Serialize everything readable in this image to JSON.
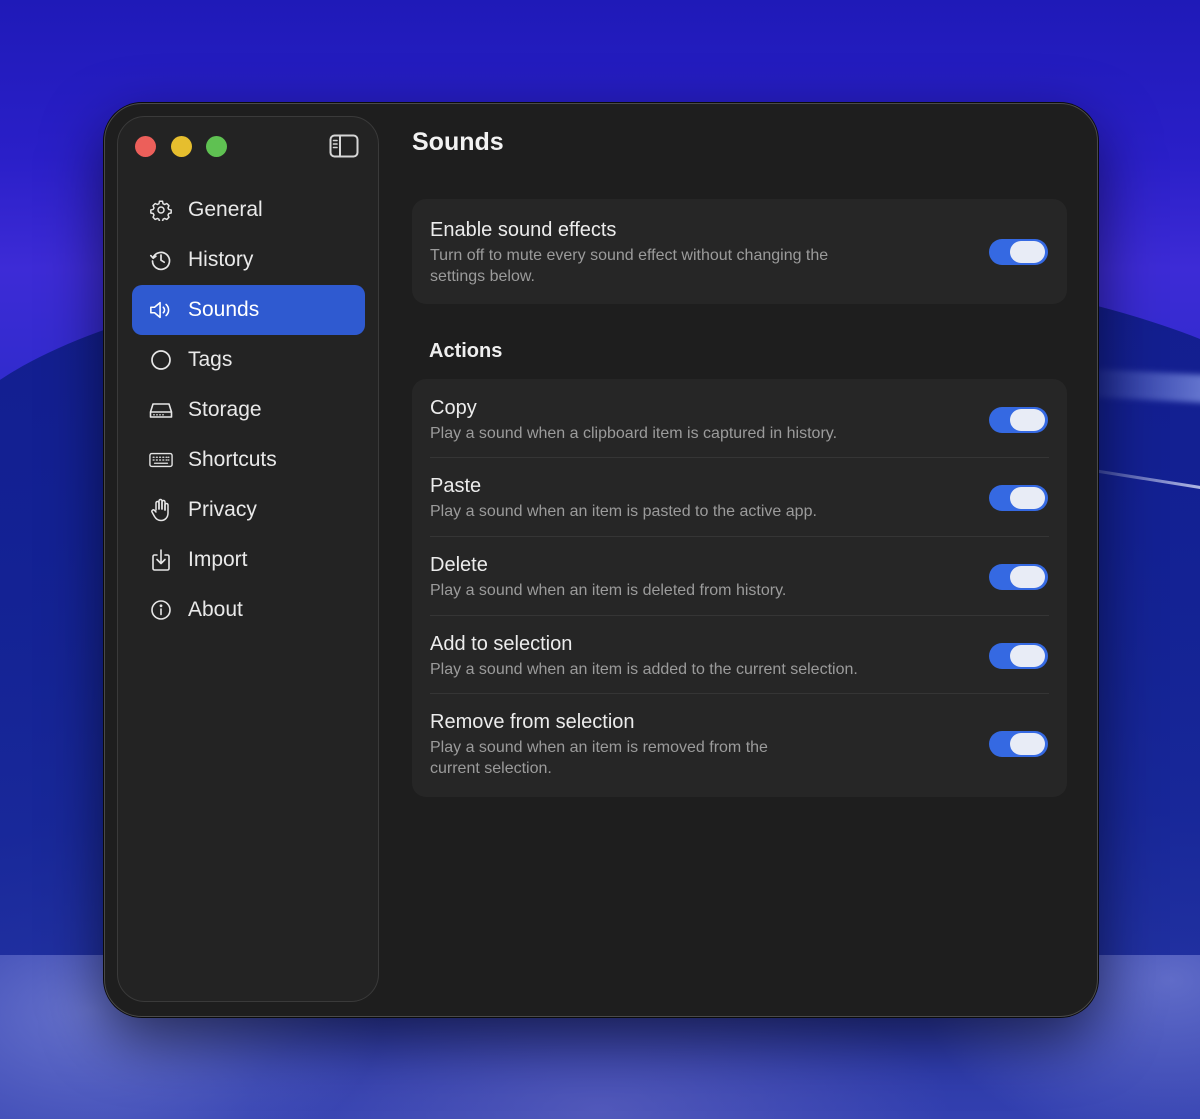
{
  "window": {
    "traffic_lights": [
      "close",
      "minimize",
      "zoom"
    ],
    "sidebar_toggle_icon": "sidebar-left-icon"
  },
  "sidebar": {
    "items": [
      {
        "label": "General",
        "icon": "gear-icon",
        "active": false
      },
      {
        "label": "History",
        "icon": "clock-history-icon",
        "active": false
      },
      {
        "label": "Sounds",
        "icon": "speaker-icon",
        "active": true
      },
      {
        "label": "Tags",
        "icon": "circle-icon",
        "active": false
      },
      {
        "label": "Storage",
        "icon": "drive-icon",
        "active": false
      },
      {
        "label": "Shortcuts",
        "icon": "keyboard-icon",
        "active": false
      },
      {
        "label": "Privacy",
        "icon": "hand-icon",
        "active": false
      },
      {
        "label": "Import",
        "icon": "import-tray-icon",
        "active": false
      },
      {
        "label": "About",
        "icon": "info-icon",
        "active": false
      }
    ]
  },
  "page": {
    "title": "Sounds",
    "master": {
      "title": "Enable sound effects",
      "description": "Turn off to mute every sound effect without changing the settings below.",
      "enabled": true
    },
    "actions_section": {
      "title": "Actions",
      "rows": [
        {
          "title": "Copy",
          "description": "Play a sound when a clipboard item is captured in history.",
          "enabled": true
        },
        {
          "title": "Paste",
          "description": "Play a sound when an item is pasted to the active app.",
          "enabled": true
        },
        {
          "title": "Delete",
          "description": "Play a sound when an item is deleted from history.",
          "enabled": true
        },
        {
          "title": "Add to selection",
          "description": "Play a sound when an item is added to the current selection.",
          "enabled": true
        },
        {
          "title": "Remove from selection",
          "description": "Play a sound when an item is removed from the current selection.",
          "enabled": true
        }
      ]
    }
  },
  "colors": {
    "accent": "#2f5ad0",
    "toggle_on": "#3569e2",
    "window_bg": "#1e1e1e",
    "sidebar_bg": "#232323",
    "card_bg": "#262626"
  }
}
